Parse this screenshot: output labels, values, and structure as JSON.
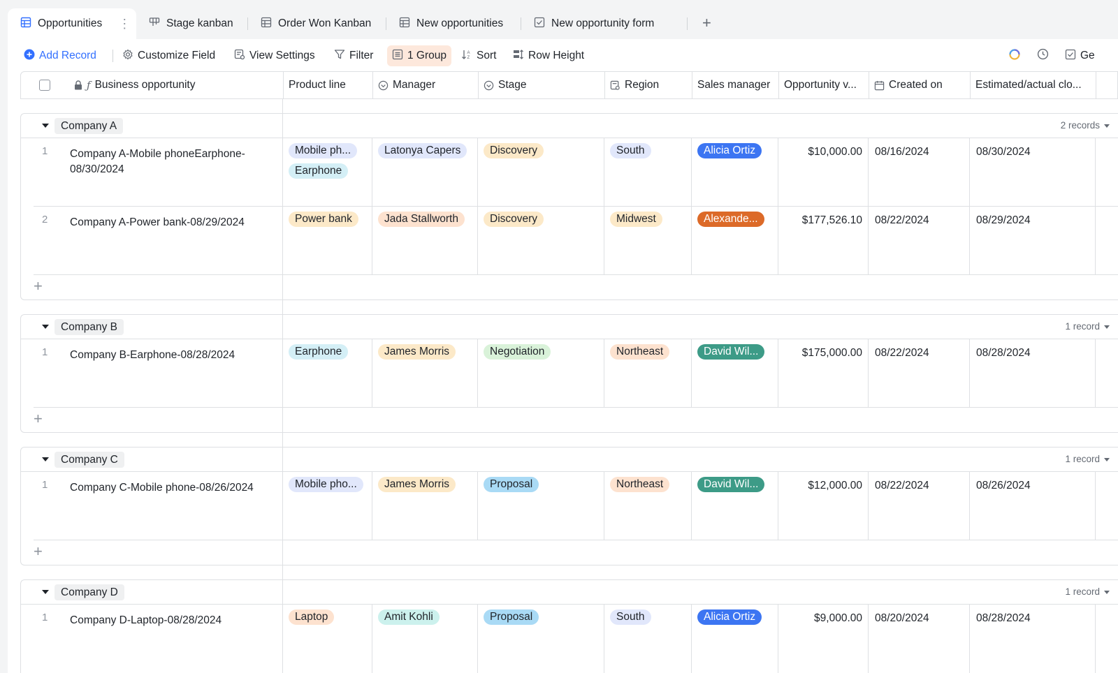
{
  "tabs": [
    {
      "label": "Opportunities",
      "icon": "grid-icon"
    },
    {
      "label": "Stage kanban",
      "icon": "kanban-icon"
    },
    {
      "label": "Order Won Kanban",
      "icon": "grid-icon"
    },
    {
      "label": "New opportunities",
      "icon": "grid-icon"
    },
    {
      "label": "New opportunity form",
      "icon": "form-icon"
    }
  ],
  "toolbar": {
    "add_record": "Add Record",
    "customize_field": "Customize Field",
    "view_settings": "View Settings",
    "filter": "Filter",
    "group": "1 Group",
    "sort": "Sort",
    "row_height": "Row Height",
    "generate_partial": "Ge"
  },
  "columns": {
    "business_opportunity": "Business opportunity",
    "product_line": "Product line",
    "manager": "Manager",
    "stage": "Stage",
    "region": "Region",
    "sales_manager": "Sales manager",
    "opportunity_value": "Opportunity v...",
    "created_on": "Created on",
    "estimated_close": "Estimated/actual clo..."
  },
  "colors": {
    "accent": "#3370ff",
    "group_button_bg": "#fde8dc",
    "tag_mobile": "#e1e7fb",
    "tag_earphone": "#d4eff6",
    "tag_yellow": "#fce9c8",
    "tag_orange": "#fde2cf",
    "tag_green": "#d9f2d9",
    "tag_blue": "#a9daf5",
    "tag_region": "#e1e7fb",
    "tag_cyan": "#ccf1ed",
    "sales_blue": "#3c75f2",
    "sales_orange": "#dc6a28",
    "sales_teal": "#3d9b87"
  },
  "groups": [
    {
      "name": "Company A",
      "count": "2 records",
      "rows": [
        {
          "num": "1",
          "name": "Company A-Mobile phoneEarphone-08/30/2024",
          "products": [
            "Mobile ph...",
            "Earphone"
          ],
          "manager": "Latonya Capers",
          "stage": "Discovery",
          "region": "South",
          "sales": "Alicia Ortiz",
          "value": "$10,000.00",
          "created": "08/16/2024",
          "close": "08/30/2024"
        },
        {
          "num": "2",
          "name": "Company A-Power bank-08/29/2024",
          "products": [
            "Power bank"
          ],
          "manager": "Jada Stallworth",
          "stage": "Discovery",
          "region": "Midwest",
          "sales": "Alexande...",
          "value": "$177,526.10",
          "created": "08/22/2024",
          "close": "08/29/2024"
        }
      ]
    },
    {
      "name": "Company B",
      "count": "1 record",
      "rows": [
        {
          "num": "1",
          "name": "Company B-Earphone-08/28/2024",
          "products": [
            "Earphone"
          ],
          "manager": "James Morris",
          "stage": "Negotiation",
          "region": "Northeast",
          "sales": "David Wil...",
          "value": "$175,000.00",
          "created": "08/22/2024",
          "close": "08/28/2024"
        }
      ]
    },
    {
      "name": "Company C",
      "count": "1 record",
      "rows": [
        {
          "num": "1",
          "name": "Company C-Mobile phone-08/26/2024",
          "products": [
            "Mobile pho..."
          ],
          "manager": "James Morris",
          "stage": "Proposal",
          "region": "Northeast",
          "sales": "David Wil...",
          "value": "$12,000.00",
          "created": "08/22/2024",
          "close": "08/26/2024"
        }
      ]
    },
    {
      "name": "Company D",
      "count": "1 record",
      "rows": [
        {
          "num": "1",
          "name": "Company D-Laptop-08/28/2024",
          "products": [
            "Laptop"
          ],
          "manager": "Amit Kohli",
          "stage": "Proposal",
          "region": "South",
          "sales": "Alicia Ortiz",
          "value": "$9,000.00",
          "created": "08/20/2024",
          "close": "08/28/2024"
        }
      ]
    }
  ]
}
